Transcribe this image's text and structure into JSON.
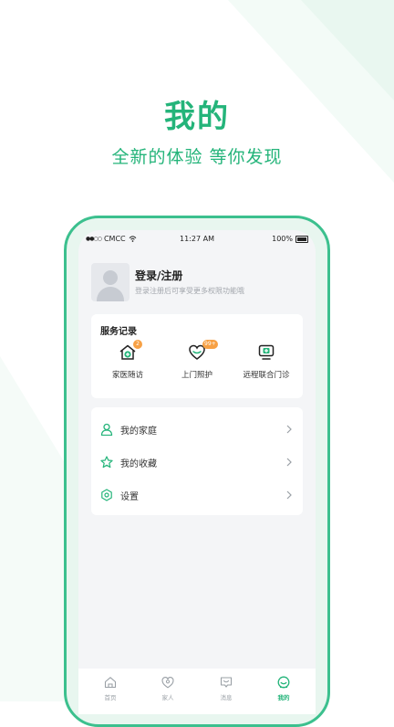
{
  "promo": {
    "title": "我的",
    "subtitle": "全新的体验 等你发现"
  },
  "status_bar": {
    "carrier": "CMCC",
    "time": "11:27 AM",
    "battery": "100%"
  },
  "profile": {
    "title": "登录/注册",
    "subtitle": "登录注册后可享受更多权限功能哦"
  },
  "services": {
    "title": "服务记录",
    "items": [
      {
        "label": "家医随访",
        "badge": "2",
        "icon": "home-plus-icon"
      },
      {
        "label": "上门照护",
        "badge": "99+",
        "icon": "heart-icon"
      },
      {
        "label": "远程联合门诊",
        "badge": "",
        "icon": "monitor-plus-icon"
      }
    ]
  },
  "menu": {
    "items": [
      {
        "label": "我的家庭",
        "icon": "user-icon"
      },
      {
        "label": "我的收藏",
        "icon": "star-icon"
      },
      {
        "label": "设置",
        "icon": "settings-icon"
      }
    ]
  },
  "tabs": [
    {
      "label": "首页",
      "icon": "home-icon",
      "active": false
    },
    {
      "label": "家人",
      "icon": "family-icon",
      "active": false
    },
    {
      "label": "消息",
      "icon": "message-icon",
      "active": false
    },
    {
      "label": "我的",
      "icon": "profile-icon",
      "active": true
    }
  ],
  "colors": {
    "accent": "#24b47a",
    "badge": "#f7a145",
    "background": "#f4f5f7"
  }
}
